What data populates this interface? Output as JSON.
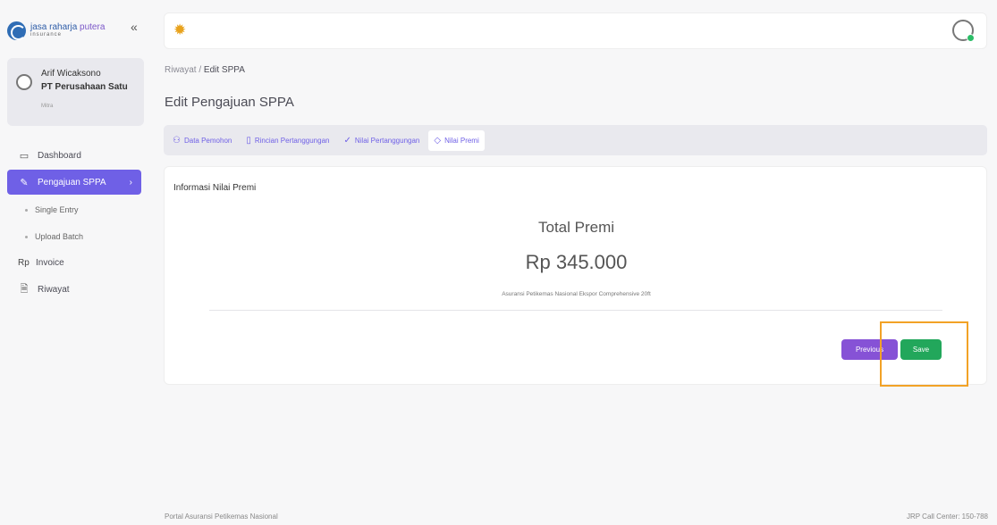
{
  "brand": {
    "name_a": "jasa raharja ",
    "name_b": "putera",
    "sub": "insurance"
  },
  "user": {
    "name": "Arif Wicaksono",
    "company": "PT Perusahaan Satu",
    "role": "Mitra"
  },
  "nav": {
    "dashboard": "Dashboard",
    "pengajuan": "Pengajuan SPPA",
    "single_entry": "Single Entry",
    "upload_batch": "Upload Batch",
    "invoice_prefix": "Rp",
    "invoice": "Invoice",
    "riwayat": "Riwayat"
  },
  "breadcrumb": {
    "parent": "Riwayat",
    "sep": " / ",
    "current": "Edit SPPA"
  },
  "page_title": "Edit Pengajuan SPPA",
  "tabs": [
    {
      "label": "Data Pemohon"
    },
    {
      "label": "Rincian Pertanggungan"
    },
    {
      "label": "Nilai Pertanggungan"
    },
    {
      "label": "Nilai Premi"
    }
  ],
  "card": {
    "title": "Informasi Nilai Premi",
    "total_label": "Total Premi",
    "total_value": "Rp 345.000",
    "product": "Asuransi Petikemas Nasional Ekspor Comprehensive 20ft"
  },
  "buttons": {
    "previous": "Previous",
    "save": "Save"
  },
  "footer": {
    "left": "Portal Asuransi Petikemas Nasional",
    "right": "JRP Call Center: 150-788"
  },
  "colors": {
    "accent": "#6f60e6",
    "save": "#22a75b",
    "previous": "#8652d6",
    "highlight": "#f2a226"
  }
}
